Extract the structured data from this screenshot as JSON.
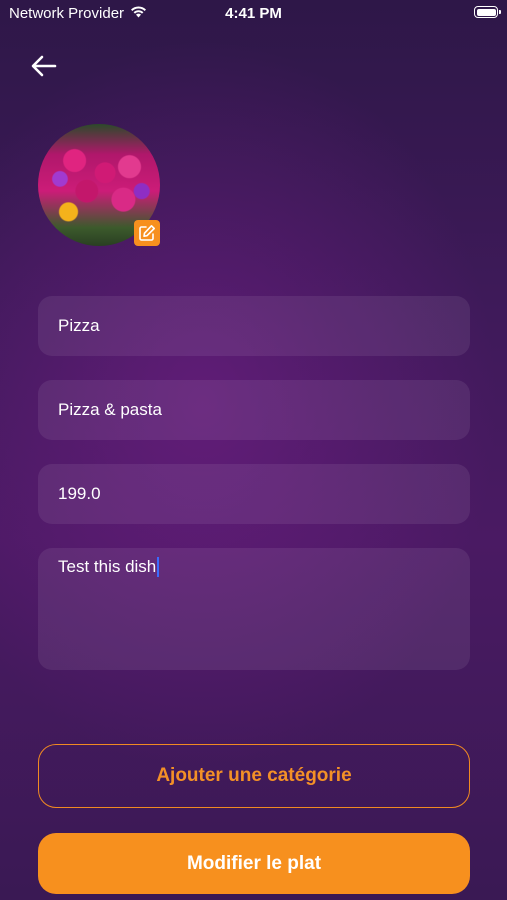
{
  "status_bar": {
    "carrier": "Network Provider",
    "time": "4:41 PM",
    "icons": [
      "wifi-icon",
      "battery-icon"
    ]
  },
  "header": {
    "back_icon": "arrow-left-icon"
  },
  "avatar": {
    "edit_icon": "edit-icon",
    "badge_color": "#f7901e"
  },
  "form": {
    "name": "Pizza",
    "category": "Pizza & pasta",
    "price": "199.0",
    "description": "Test this dish"
  },
  "buttons": {
    "add_category": "Ajouter une catégorie",
    "submit": "Modifier le plat"
  },
  "colors": {
    "accent": "#f7901e",
    "background": "#3f1a5a"
  }
}
